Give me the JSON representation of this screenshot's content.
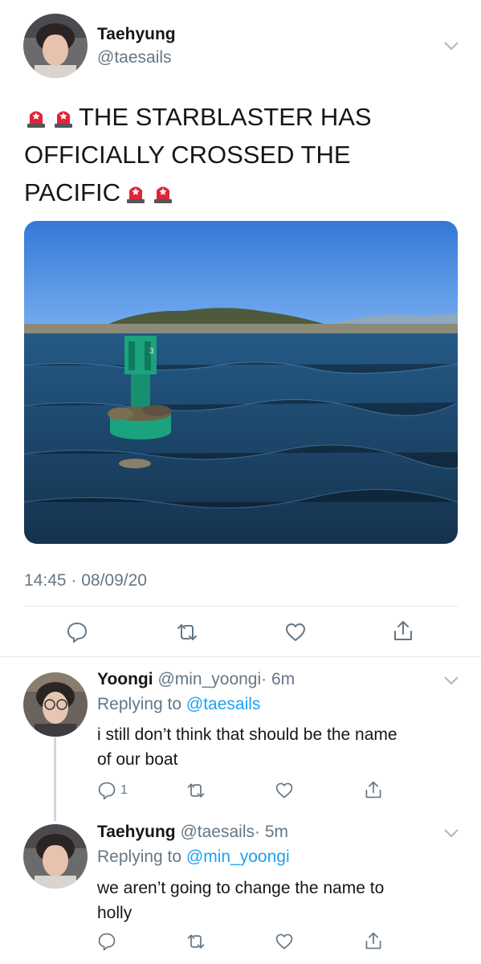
{
  "main_tweet": {
    "author_name": "Taehyung",
    "author_handle": "@taesails",
    "text_line1": "THE STARBLASTER HAS",
    "text_line2": "OFFICIALLY CROSSED THE",
    "text_line3": "PACIFIC",
    "timestamp": "14:45 · 08/09/20",
    "photo_buoy_number": "3"
  },
  "replies": [
    {
      "author_name": "Yoongi",
      "author_handle": "@min_yoongi",
      "time": "· 6m",
      "replying_label": "Replying to",
      "replying_handle": "@taesails",
      "text_line1": "i still don’t think that should be the name",
      "text_line2": "of our boat",
      "reply_count": "1"
    },
    {
      "author_name": "Taehyung",
      "author_handle": "@taesails",
      "time": "· 5m",
      "replying_label": "Replying to",
      "replying_handle": "@min_yoongi",
      "text_line1": "we aren’t going to change the name to",
      "text_line2": "holly",
      "reply_count": ""
    }
  ],
  "icons": [
    "siren-icon",
    "chevron-down-icon",
    "reply-icon",
    "retweet-icon",
    "like-icon",
    "share-icon"
  ],
  "colors": {
    "link": "#1da1f2",
    "muted": "#657786",
    "divider": "#e1e8ed",
    "sky": "#3f86dd",
    "sea": "#1b3f5e",
    "buoy": "#1aa37e"
  }
}
